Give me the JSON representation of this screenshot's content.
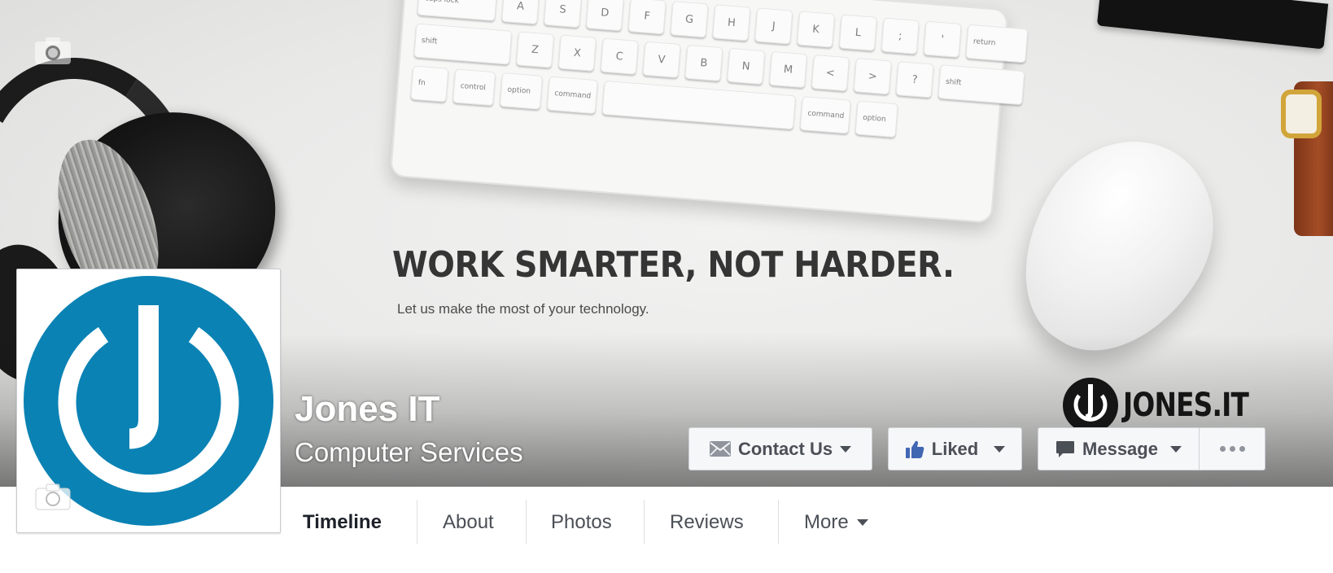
{
  "cover": {
    "slogan": "WORK SMARTER, NOT HARDER.",
    "tagline": "Let us make the most of your technology.",
    "logo_text": "JONES.IT",
    "keyboard_rows": [
      [
        "caps lock",
        "A",
        "S",
        "D",
        "F",
        "G",
        "H",
        "J",
        "K",
        "L",
        ";",
        "'",
        "return"
      ],
      [
        "shift",
        "Z",
        "X",
        "C",
        "V",
        "B",
        "N",
        "M",
        "<",
        ">",
        "?",
        "shift"
      ],
      [
        "fn",
        "control",
        "option",
        "command",
        "",
        "command",
        "option"
      ]
    ]
  },
  "page": {
    "name": "Jones IT",
    "category": "Computer Services"
  },
  "actions": {
    "contact_label": "Contact Us",
    "liked_label": "Liked",
    "message_label": "Message"
  },
  "tabs": [
    {
      "label": "Timeline",
      "active": true
    },
    {
      "label": "About",
      "active": false
    },
    {
      "label": "Photos",
      "active": false
    },
    {
      "label": "Reviews",
      "active": false
    },
    {
      "label": "More",
      "active": false
    }
  ],
  "icons": {
    "cover_camera": "camera-icon",
    "profile_camera": "camera-icon",
    "contact": "envelope-icon",
    "liked": "thumbs-up-icon",
    "message": "speech-bubble-icon",
    "more": "ellipsis-icon"
  },
  "colors": {
    "brand_blue": "#0a82b4",
    "facebook_blue": "#4267b2",
    "button_text": "#4b4f56"
  }
}
